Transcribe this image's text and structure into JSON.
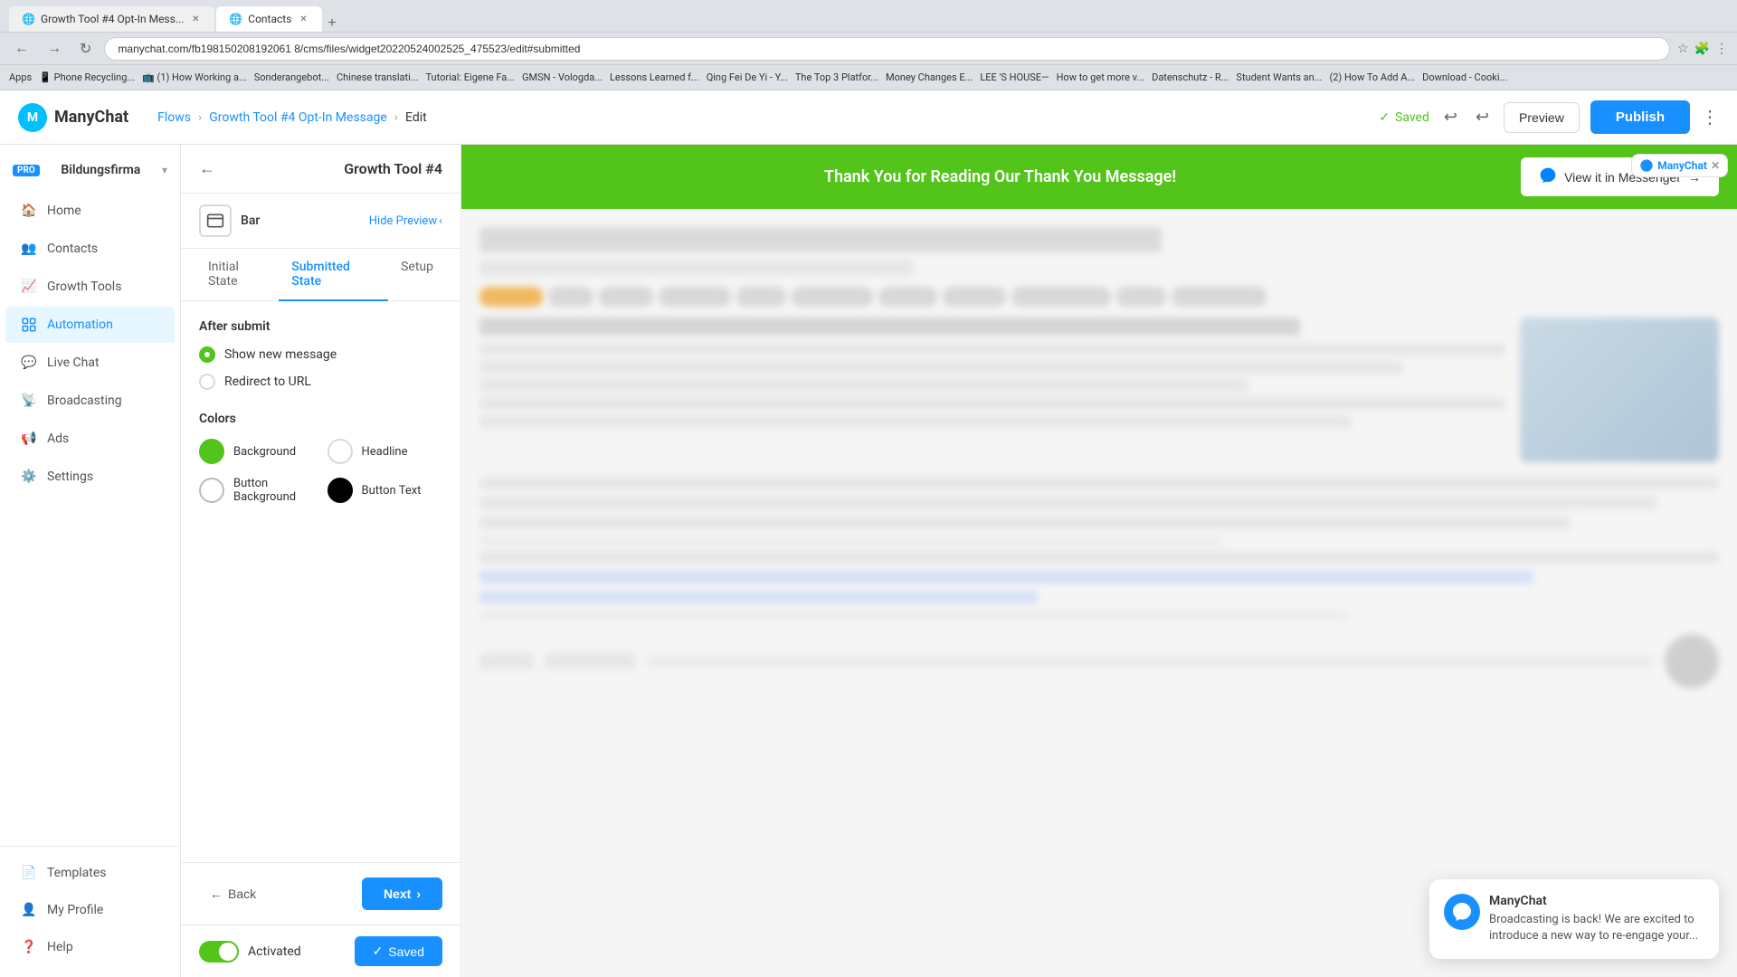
{
  "browser": {
    "tabs": [
      {
        "label": "Growth Tool #4 Opt-In Mess...",
        "active": true,
        "closable": true
      },
      {
        "label": "Contacts",
        "active": false,
        "closable": true
      }
    ],
    "address": "manychat.com/fb198150208192061 8/cms/files/widget20220524002525_475523/edit#submitted",
    "new_tab_label": "+"
  },
  "bookmarks": [
    "Apps",
    "Phone Recycling...",
    "(1) How Working a...",
    "Sonderangebot...",
    "Chinese translati...",
    "Tutorial: Eigene Fa...",
    "GMSN - Vologda...",
    "Lessons Learned f...",
    "Qing Fei De Yi - Y...",
    "The Top 3 Platfor...",
    "Money Changes E...",
    "LEE 'S HOUSE—",
    "How to get more v...",
    "Datenschutz - R...",
    "Student Wants an...",
    "(2) How To Add A...",
    "Download - Cooki..."
  ],
  "topnav": {
    "logo_letter": "M",
    "logo_text": "ManyChat",
    "breadcrumb": {
      "flows": "Flows",
      "separator1": ">",
      "growth_tool": "Growth Tool #4 Opt-In Message",
      "separator2": ">",
      "current": "Edit"
    },
    "saved_text": "Saved",
    "preview_label": "Preview",
    "publish_label": "Publish"
  },
  "sidebar": {
    "workspace_name": "Bildungsfirma",
    "workspace_badge": "PRO",
    "nav_items": [
      {
        "id": "home",
        "label": "Home",
        "icon": "🏠"
      },
      {
        "id": "contacts",
        "label": "Contacts",
        "icon": "👥"
      },
      {
        "id": "growth-tools",
        "label": "Growth Tools",
        "icon": "📈"
      },
      {
        "id": "automation",
        "label": "Automation",
        "icon": "⚙️",
        "active": true
      },
      {
        "id": "live-chat",
        "label": "Live Chat",
        "icon": "💬"
      },
      {
        "id": "broadcasting",
        "label": "Broadcasting",
        "icon": "📡"
      },
      {
        "id": "ads",
        "label": "Ads",
        "icon": "📢"
      },
      {
        "id": "settings",
        "label": "Settings",
        "icon": "⚙️"
      }
    ],
    "bottom_items": [
      {
        "id": "templates",
        "label": "Templates",
        "icon": "📄"
      },
      {
        "id": "my-profile",
        "label": "My Profile",
        "icon": "👤"
      },
      {
        "id": "help",
        "label": "Help",
        "icon": "❓"
      }
    ]
  },
  "leftpanel": {
    "title": "Growth Tool #4",
    "bar_label": "Bar",
    "hide_preview": "Hide Preview",
    "tabs": [
      {
        "id": "initial",
        "label": "Initial State"
      },
      {
        "id": "submitted",
        "label": "Submitted State",
        "active": true
      },
      {
        "id": "setup",
        "label": "Setup"
      }
    ],
    "after_submit_label": "After submit",
    "radio_options": [
      {
        "id": "show-new-message",
        "label": "Show new message",
        "selected": true
      },
      {
        "id": "redirect-to-url",
        "label": "Redirect to URL",
        "selected": false
      }
    ],
    "colors_label": "Colors",
    "color_options": [
      {
        "id": "background",
        "label": "Background",
        "color": "green"
      },
      {
        "id": "headline",
        "label": "Headline",
        "color": "white"
      },
      {
        "id": "button-background",
        "label": "Button Background",
        "color": "white-border"
      },
      {
        "id": "button-text",
        "label": "Button Text",
        "color": "black"
      }
    ],
    "back_label": "Back",
    "next_label": "Next",
    "toggle_label": "Activated",
    "saved_label": "Saved"
  },
  "banner": {
    "text": "Thank You for Reading Our Thank You Message!",
    "view_in_messenger": "View it in Messenger",
    "arrow": "→"
  },
  "chat_widget": {
    "name": "ManyChat",
    "message": "Broadcasting is back! We are excited to introduce a new way to re-engage your..."
  }
}
